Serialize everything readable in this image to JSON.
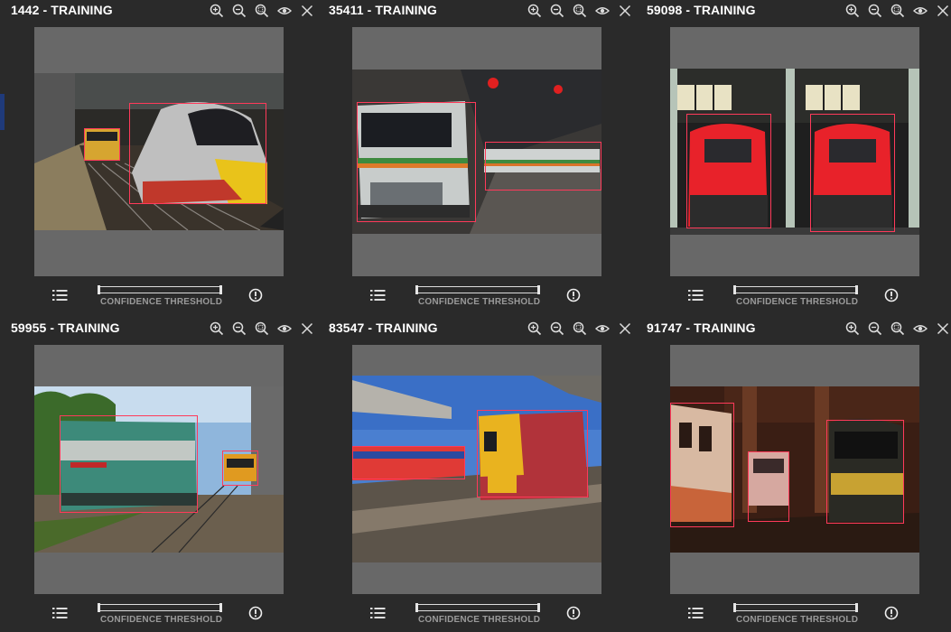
{
  "colors": {
    "background": "#2a2a2a",
    "viewport": "#686868",
    "bbox": "#ff3a5a",
    "label": "#9a9a9a"
  },
  "cards": [
    {
      "title": "1442 - TRAINING",
      "slider_label": "CONFIDENCE THRESHOLD",
      "detections": 2
    },
    {
      "title": "35411 - TRAINING",
      "slider_label": "CONFIDENCE THRESHOLD",
      "detections": 2
    },
    {
      "title": "59098 - TRAINING",
      "slider_label": "CONFIDENCE THRESHOLD",
      "detections": 2
    },
    {
      "title": "59955 - TRAINING",
      "slider_label": "CONFIDENCE THRESHOLD",
      "detections": 2
    },
    {
      "title": "83547 - TRAINING",
      "slider_label": "CONFIDENCE THRESHOLD",
      "detections": 2
    },
    {
      "title": "91747 - TRAINING",
      "slider_label": "CONFIDENCE THRESHOLD",
      "detections": 3
    }
  ],
  "icons": [
    "zoom-in-icon",
    "zoom-out-icon",
    "zoom-fit-icon",
    "eye-icon",
    "close-icon",
    "list-icon",
    "alert-icon"
  ]
}
